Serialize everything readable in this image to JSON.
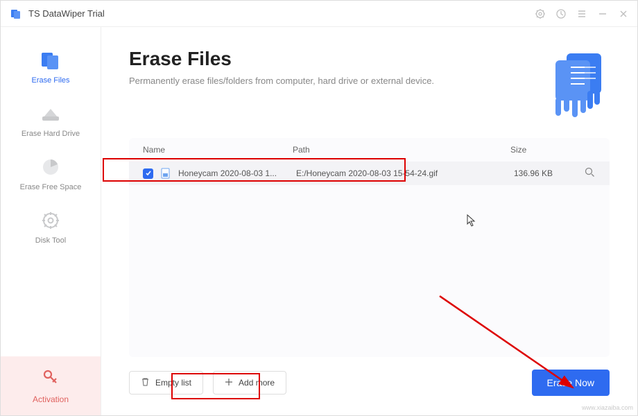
{
  "app": {
    "title": "TS DataWiper Trial"
  },
  "sidebar": {
    "items": [
      {
        "label": "Erase Files"
      },
      {
        "label": "Erase Hard Drive"
      },
      {
        "label": "Erase Free Space"
      },
      {
        "label": "Disk Tool"
      }
    ],
    "activation": {
      "label": "Activation"
    }
  },
  "main": {
    "title": "Erase Files",
    "subtitle": "Permanently erase files/folders from computer, hard drive or external device.",
    "columns": {
      "name": "Name",
      "path": "Path",
      "size": "Size"
    },
    "rows": [
      {
        "name": "Honeycam 2020-08-03 1...",
        "path": "E:/Honeycam 2020-08-03 15-54-24.gif",
        "size": "136.96 KB"
      }
    ],
    "buttons": {
      "empty": "Empty list",
      "add": "Add more",
      "erase": "Erase Now"
    }
  },
  "watermark": "www.xiazaiba.com"
}
